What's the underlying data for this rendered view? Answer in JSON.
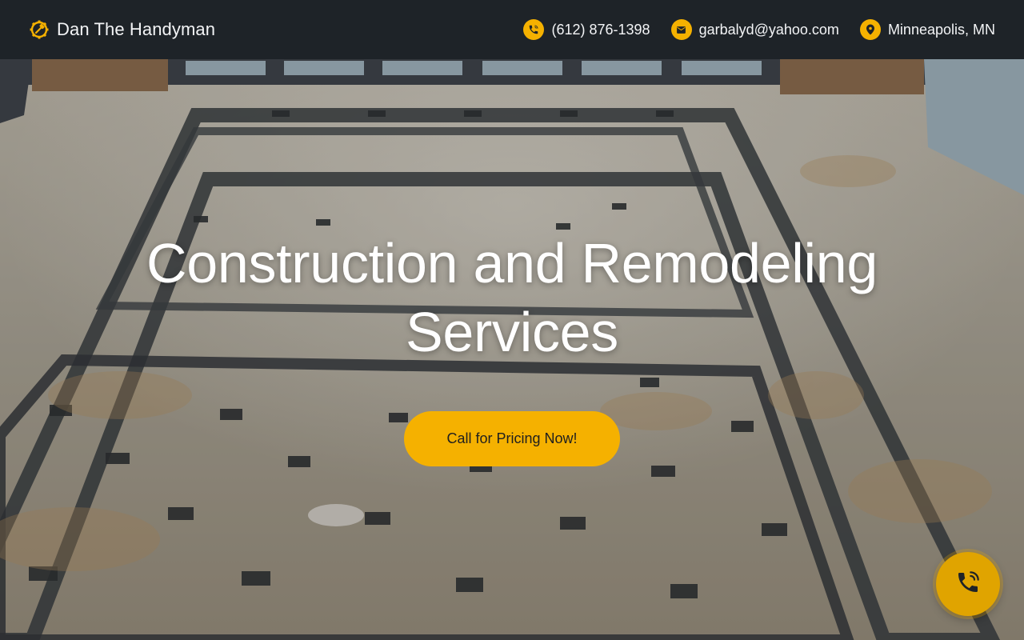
{
  "header": {
    "brand_name": "Dan The Handyman",
    "brand_icon": "gear-hammer-icon",
    "phone": "(612) 876-1398",
    "email": "garbalyd@yahoo.com",
    "location": "Minneapolis, MN"
  },
  "hero": {
    "title": "Construction and Remodeling Services",
    "cta_label": "Call for Pricing Now!",
    "background": "polished marble tile floor with dark inlaid border"
  },
  "floating_button": {
    "icon": "phone-ringing-icon"
  },
  "colors": {
    "header_bg": "#1e2328",
    "accent": "#f5b100",
    "text_light": "#f3f4f6"
  }
}
